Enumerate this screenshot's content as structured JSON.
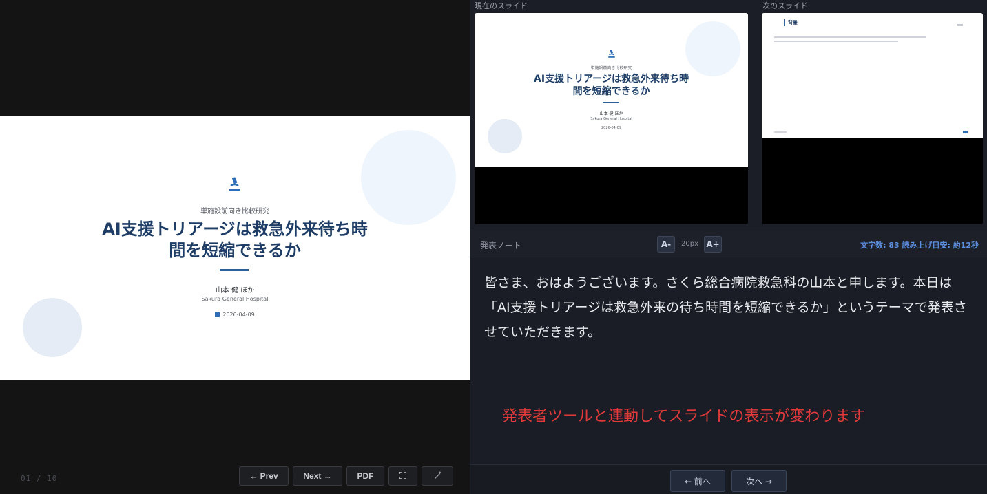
{
  "slide": {
    "subtitle": "単施設前向き比較研究",
    "title_line1": "AI支援トリアージは救急外来待ち時",
    "title_line2": "間を短縮できるか",
    "author": "山本 健 ほか",
    "affiliation": "Sakura General Hospital",
    "date": "2026-04-09",
    "icon": "microscope-icon",
    "accent_color": "#1d3d66"
  },
  "viewer": {
    "page_counter": "01 / 10",
    "prev_label": "← Prev",
    "next_label": "Next →",
    "pdf_label": "PDF",
    "fullscreen_icon": "fullscreen-icon",
    "pen_icon": "pen-icon"
  },
  "presenter": {
    "current_label": "現在のスライド",
    "next_label": "次のスライド",
    "next_slide": {
      "heading": "背景"
    },
    "notes_label": "発表ノート",
    "font_decrease": "A-",
    "font_size": "20px",
    "font_increase": "A+",
    "stats": "文字数: 83  読み上げ目安: 約12秒",
    "notes_text": "皆さま、おはようございます。さくら総合病院救急科の山本と申します。本日は「AI支援トリアージは救急外来の待ち時間を短縮できるか」というテーマで発表させていただきます。",
    "overlay_note": "発表者ツールと連動してスライドの表示が変わります",
    "prev_button": "← 前へ",
    "next_button": "次へ →"
  }
}
